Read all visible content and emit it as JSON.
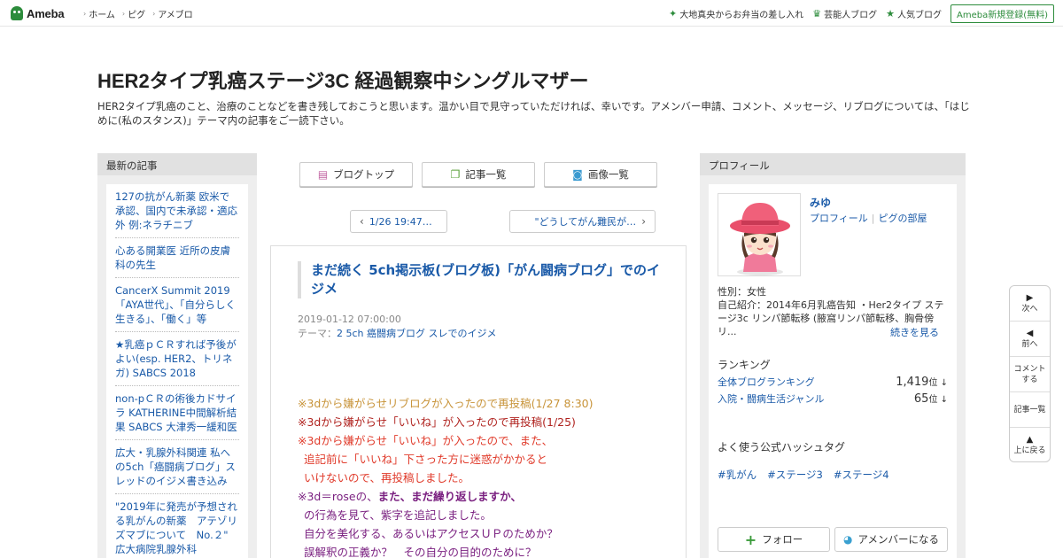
{
  "header": {
    "logo": "Ameba",
    "nav": [
      "ホーム",
      "ピグ",
      "アメブロ"
    ],
    "right_links": [
      {
        "label": "大地真央からお弁当の差し入れ",
        "icon": "sparkle-icon"
      },
      {
        "label": "芸能人ブログ",
        "icon": "crown-icon"
      },
      {
        "label": "人気ブログ",
        "icon": "star-icon"
      }
    ],
    "register": "Ameba新規登録(無料)"
  },
  "blog": {
    "title": "HER2タイプ乳癌ステージ3C 経過観察中シングルマザー",
    "description": "HER2タイプ乳癌のこと、治療のことなどを書き残しておこうと思います。温かい目で見守っていただければ、幸いです。アメンバー申請、コメント、メッセージ、リブログについては、「はじめに(私のスタンス)」テーマ内の記事をご一読下さい。"
  },
  "left_sidebar": {
    "heading": "最新の記事",
    "items": [
      "127の抗がん新薬 欧米で承認、国内で未承認・適応外 例:ネラチニブ",
      "心ある開業医 近所の皮膚科の先生",
      "CancerX Summit 2019 「AYA世代」、「自分らしく生きる」、「働く」等",
      "★乳癌ｐＣＲすれば予後がよい(esp. HER2、トリネガ) SABCS 2018",
      "non-pＣＲの術後カドサイラ KATHERINE中間解析結果 SABCS 大津秀一緩和医",
      "広大・乳腺外科関連 私への5ch「癌闘病ブログ」スレッドのイジメ書き込み",
      "\"2019年に発売が予想される乳がんの新薬　アテゾリズマブについて　No.２\" 広大病院乳腺外科"
    ]
  },
  "center": {
    "buttons": [
      {
        "label": "ブログトップ",
        "icon": "blog-top-icon"
      },
      {
        "label": "記事一覧",
        "icon": "article-list-icon"
      },
      {
        "label": "画像一覧",
        "icon": "camera-icon"
      }
    ],
    "prev": "1/26 19:47…",
    "next": "\"どうしてがん難民が…"
  },
  "article": {
    "title": "まだ続く 5ch掲示板(ブログ板)「がん闘病ブログ」でのイジメ",
    "date": "2019-01-12 07:00:00",
    "theme_label": "テーマ：",
    "theme": "2 5ch 癌闘病ブログ スレでのイジメ",
    "lines": {
      "l1": "※3dから嫌がらせリブログが入ったので再投稿(1/27 8:30)",
      "l2": "※3dから嫌がらせ「いいね」が入ったので再投稿(1/25)",
      "l3": "※3dから嫌がらせ「いいね」が入ったので、また、",
      "l4": "追記前に「いいね」下さった方に迷惑がかかると",
      "l5": "いけないので、再投稿しました。",
      "l6a": "※3d＝roseの、",
      "l6b": "また、まだ繰り返しますか、",
      "l7": "の行為を見て、紫字を追記しました。",
      "l8": "自分を美化する、あるいはアクセスＵＰのためか？",
      "l9": "誤解釈の正義か？　その自分の目的のために？"
    }
  },
  "profile": {
    "heading": "プロフィール",
    "name": "みゆ",
    "link_profile": "プロフィール",
    "link_pig": "ピグの部屋",
    "gender": "性別：女性",
    "intro": "自己紹介：2014年6月乳癌告知 ・Her2タイプ ステージ3c リンパ節転移 (腋窩リンパ節転移、胸骨傍リ...",
    "more": "続きを見る",
    "ranking_heading": "ランキング",
    "rankings": [
      {
        "label": "全体ブログランキング",
        "value": "1,419",
        "unit": "位 ↓"
      },
      {
        "label": "入院・闘病生活ジャンル",
        "value": "65",
        "unit": "位 ↓"
      }
    ],
    "hashtag_heading": "よく使う公式ハッシュタグ",
    "hashtags": [
      "#乳がん",
      "#ステージ3",
      "#ステージ4"
    ],
    "follow": "フォロー",
    "amember": "アメンバーになる"
  },
  "float_nav": {
    "next": "次へ",
    "prev": "前へ",
    "comment": "コメントする",
    "list": "記事一覧",
    "top": "上に戻る"
  },
  "colors": {
    "brand_green": "#2d8c3c",
    "link_blue": "#1a5aa8",
    "note_gold": "#c8943a",
    "note_red": "#b0231f",
    "note_orange_red": "#e03a2a",
    "note_purple": "#7a2080"
  }
}
